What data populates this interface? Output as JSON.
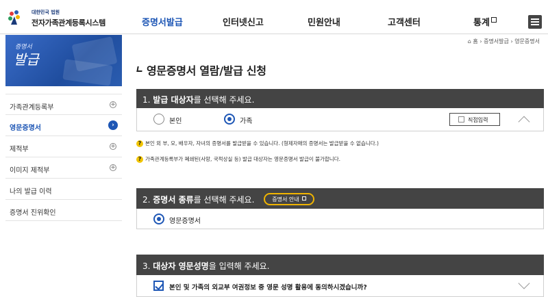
{
  "header": {
    "logo_small": "대한민국 법원",
    "logo_title": "전자가족관계등록시스템",
    "nav": [
      {
        "label": "증명서발급",
        "active": true
      },
      {
        "label": "인터넷신고"
      },
      {
        "label": "민원안내"
      },
      {
        "label": "고객센터"
      },
      {
        "label": "통계",
        "external": true
      }
    ],
    "menu_icon": "hamburger-icon"
  },
  "sidebar": {
    "banner_small": "증명서",
    "banner_big": "발급",
    "items": [
      {
        "label": "가족관계등록부",
        "icon": "plus-icon"
      },
      {
        "label": "영문증명서",
        "active": true,
        "icon": "arrow-right-icon"
      },
      {
        "label": "제적부",
        "icon": "plus-icon"
      },
      {
        "label": "이미지 제적부",
        "icon": "plus-icon"
      },
      {
        "label": "나의 발급 이력"
      },
      {
        "label": "증명서 진위확인"
      }
    ]
  },
  "breadcrumb": {
    "home": "홈",
    "level1": "증명서발급",
    "level2": "영문증명서"
  },
  "page_title": "영문증명서 열람/발급 신청",
  "section1": {
    "prefix": "1. ",
    "bold": "발급 대상자",
    "rest": "를 선택해 주세요.",
    "options": [
      "본인",
      "가족"
    ],
    "selected": "가족",
    "direct_label": "직접입력",
    "note1": "본인 외 부, 모, 배우자, 자녀의 증명서를 발급받을 수 있습니다. (형제자매의 증명서는 발급받을 수 없습니다.)",
    "note2": "가족관계등록부가 폐쇄된(사망, 국적상실 등) 발급 대상자는 영문증명서 발급이 불가합니다."
  },
  "section2": {
    "prefix": "2. ",
    "bold": "증명서 종류",
    "rest": "를 선택해 주세요.",
    "guide_label": "증명서 안내",
    "option": "영문증명서"
  },
  "section3": {
    "prefix": "3. ",
    "bold": "대상자 영문성명",
    "rest": "을 입력해 주세요.",
    "consent": "본인 및 가족의 외교부 여권정보 중 영문 성명 활용에 동의하시겠습니까?",
    "consent_checked": true
  },
  "colors": {
    "accent": "#1d56b5",
    "section_header": "#444444",
    "help": "#f2c500"
  }
}
